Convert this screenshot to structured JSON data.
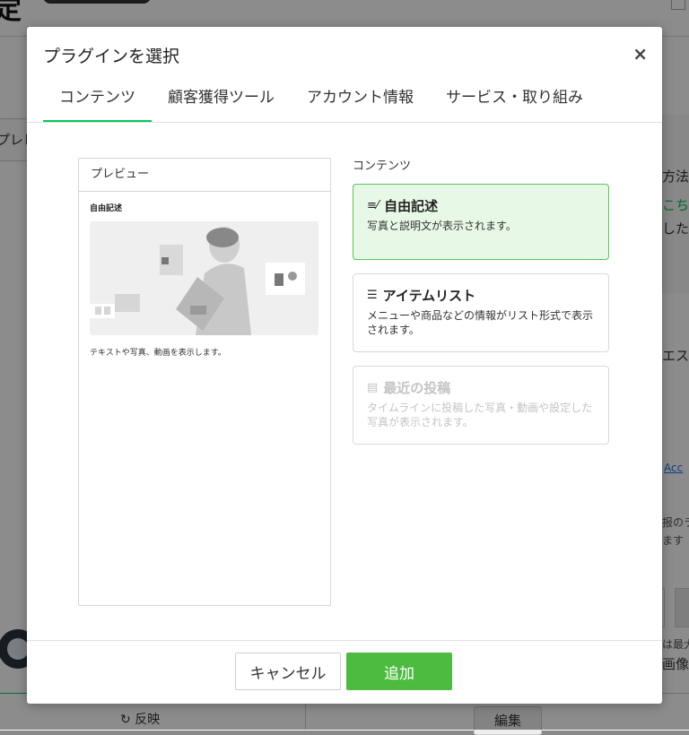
{
  "background": {
    "refresh_label": "反映",
    "edit_label": "編集",
    "right_texts": [
      "方法",
      "こち",
      "した",
      "エス",
      "报のラ",
      "ます",
      "は最大",
      "画像"
    ],
    "link_text": "Acc",
    "left_tab_label": "プレビ"
  },
  "modal": {
    "title": "プラグインを選択",
    "close_label": "×",
    "tabs": [
      {
        "label": "コンテンツ",
        "active": true
      },
      {
        "label": "顧客獲得ツール",
        "active": false
      },
      {
        "label": "アカウント情報",
        "active": false
      },
      {
        "label": "サービス・取り組み",
        "active": false
      }
    ],
    "preview": {
      "header": "プレビュー",
      "item_name": "自由記述",
      "description": "テキストや写真、動画を表示します。"
    },
    "section_label": "コンテンツ",
    "cards": [
      {
        "icon": "free-text-icon",
        "icon_glyph": "≡⁄",
        "title": "自由記述",
        "description": "写真と説明文が表示されます。",
        "state": "selected"
      },
      {
        "icon": "item-list-icon",
        "icon_glyph": "☰",
        "title": "アイテムリスト",
        "description": "メニューや商品などの情報がリスト形式で表示されます。",
        "state": "normal"
      },
      {
        "icon": "recent-posts-icon",
        "icon_glyph": "▤",
        "title": "最近の投稿",
        "description": "タイムラインに投稿した写真・動画や設定した写真が表示されます。",
        "state": "disabled"
      }
    ],
    "cancel_label": "キャンセル",
    "add_label": "追加"
  },
  "colors": {
    "accent": "#4cbb3f",
    "selected_bg": "#e8f8e6",
    "tab_underline": "#06c755"
  }
}
